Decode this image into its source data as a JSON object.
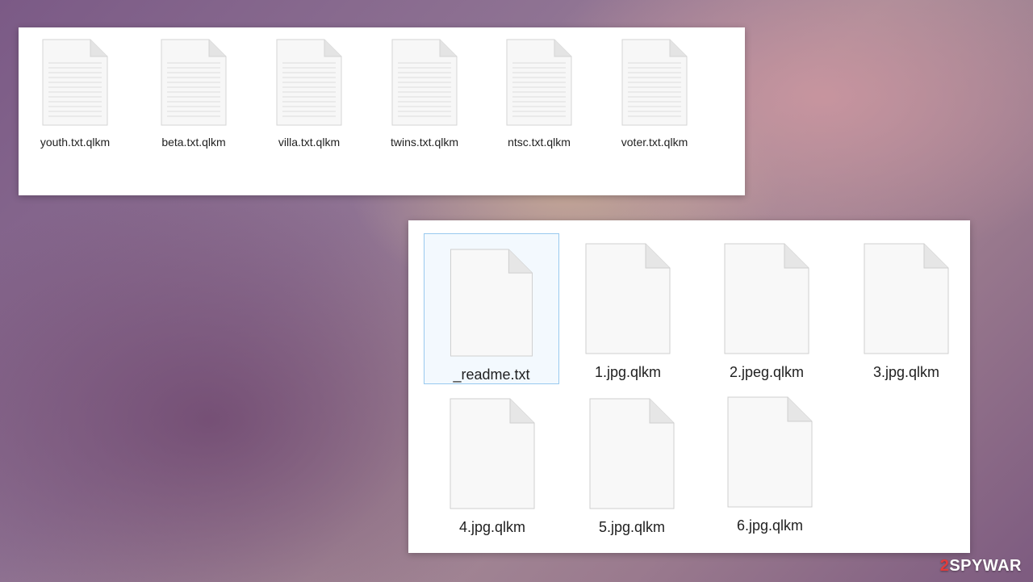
{
  "top_panel": {
    "files": [
      {
        "name": "youth.txt.qlkm",
        "icon": "text-file-icon"
      },
      {
        "name": "beta.txt.qlkm",
        "icon": "text-file-icon"
      },
      {
        "name": "villa.txt.qlkm",
        "icon": "text-file-icon"
      },
      {
        "name": "twins.txt.qlkm",
        "icon": "text-file-icon"
      },
      {
        "name": "ntsc.txt.qlkm",
        "icon": "text-file-icon"
      },
      {
        "name": "voter.txt.qlkm",
        "icon": "text-file-icon"
      }
    ]
  },
  "bottom_panel": {
    "files": [
      {
        "name": "_readme.txt",
        "icon": "blank-file-icon",
        "selected": true
      },
      {
        "name": "1.jpg.qlkm",
        "icon": "blank-file-icon"
      },
      {
        "name": "2.jpeg.qlkm",
        "icon": "blank-file-icon"
      },
      {
        "name": "3.jpg.qlkm",
        "icon": "blank-file-icon"
      },
      {
        "name": "4.jpg.qlkm",
        "icon": "blank-file-icon"
      },
      {
        "name": "5.jpg.qlkm",
        "icon": "blank-file-icon"
      },
      {
        "name": "6.jpg.qlkm",
        "icon": "blank-file-icon"
      }
    ],
    "selection_color": "#99c9ef"
  },
  "watermark": {
    "prefix": "2",
    "text": "SPYWAR",
    "accent_color": "#e23b3b"
  }
}
